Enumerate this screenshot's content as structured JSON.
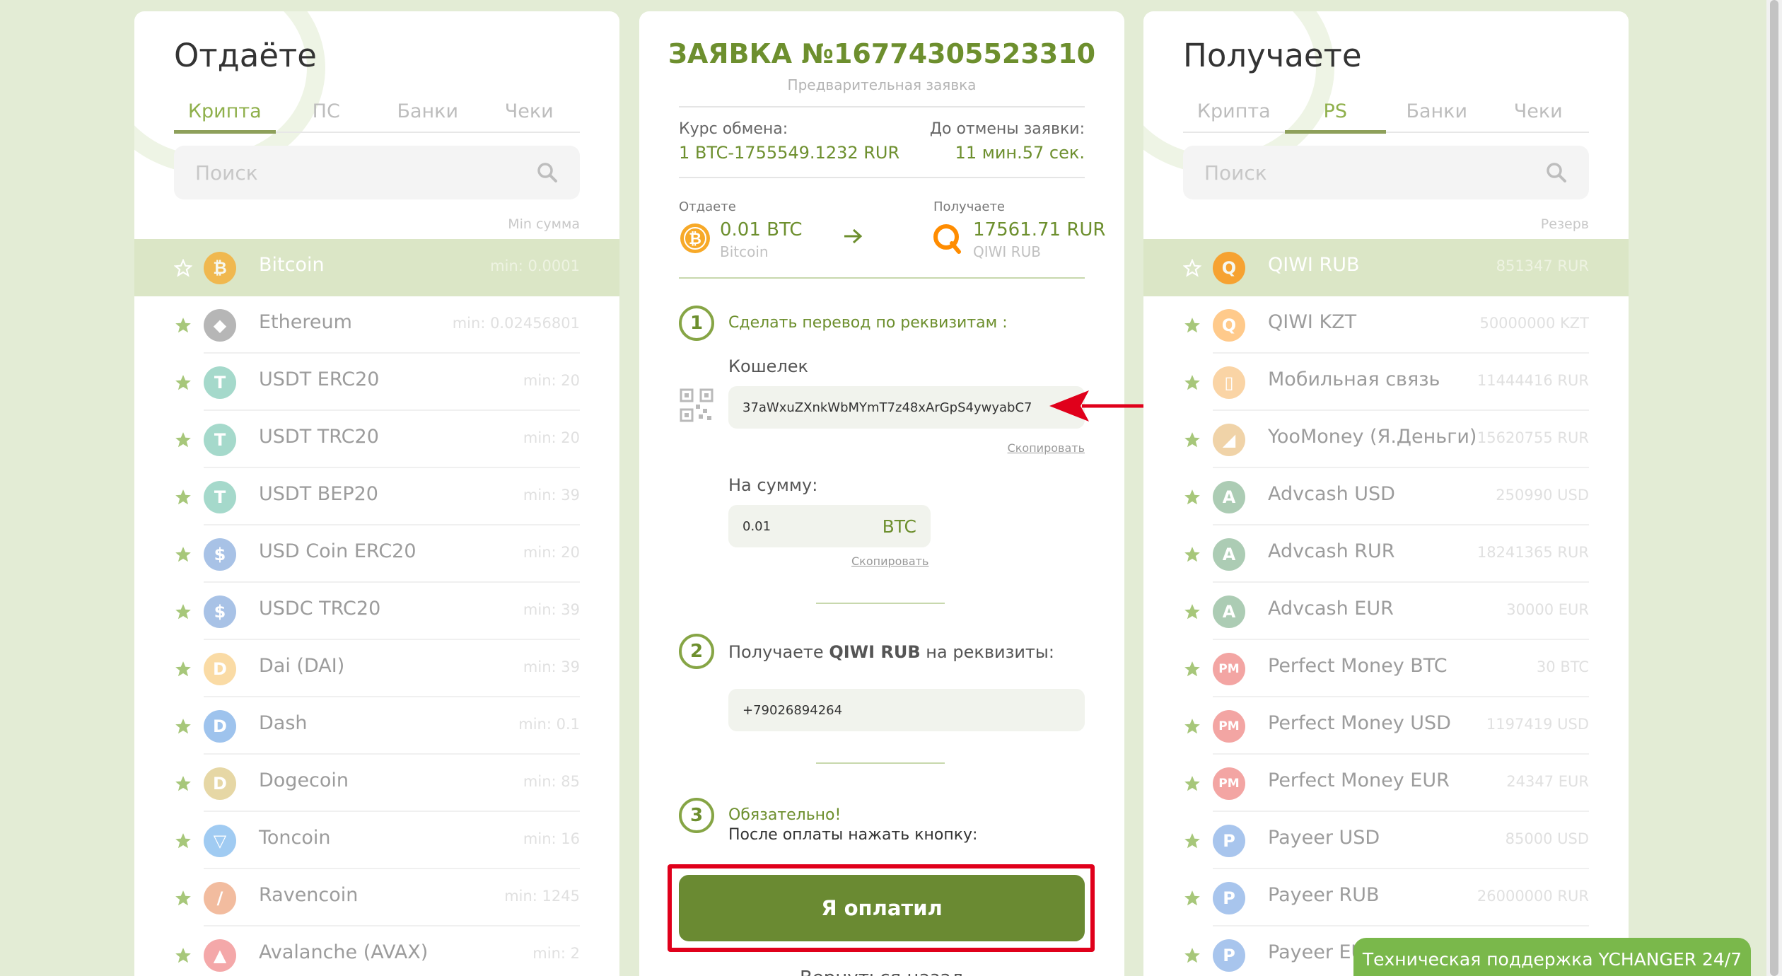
{
  "left_panel": {
    "title": "Отдаёте",
    "tabs": [
      "Крипта",
      "ПС",
      "Банки",
      "Чеки"
    ],
    "active_tab": 0,
    "search_placeholder": "Поиск",
    "col_head": "Min сумма",
    "items": [
      {
        "name": "Bitcoin",
        "amount": "min: 0.0001",
        "icon": "bitcoin-icon",
        "color": "#f7a928",
        "glyph": "₿",
        "active": true
      },
      {
        "name": "Ethereum",
        "amount": "min: 0.02456801",
        "icon": "ethereum-icon",
        "color": "#5e5e5e",
        "glyph": "◆"
      },
      {
        "name": "USDT ERC20",
        "amount": "min: 20",
        "icon": "tether-icon",
        "color": "#3aac8e",
        "glyph": "T"
      },
      {
        "name": "USDT TRC20",
        "amount": "min: 20",
        "icon": "tether-icon",
        "color": "#3aac8e",
        "glyph": "T"
      },
      {
        "name": "USDT BEP20",
        "amount": "min: 39",
        "icon": "tether-icon",
        "color": "#3aac8e",
        "glyph": "T"
      },
      {
        "name": "USD Coin ERC20",
        "amount": "min: 20",
        "icon": "usdc-icon",
        "color": "#3f79c9",
        "glyph": "$"
      },
      {
        "name": "USDC TRC20",
        "amount": "min: 39",
        "icon": "usdc-icon",
        "color": "#3f79c9",
        "glyph": "$"
      },
      {
        "name": "Dai (DAI)",
        "amount": "min: 39",
        "icon": "dai-icon",
        "color": "#f4b13a",
        "glyph": "D"
      },
      {
        "name": "Dash",
        "amount": "min: 0.1",
        "icon": "dash-icon",
        "color": "#2a7bd8",
        "glyph": "D"
      },
      {
        "name": "Dogecoin",
        "amount": "min: 85",
        "icon": "dogecoin-icon",
        "color": "#c8a83a",
        "glyph": "D"
      },
      {
        "name": "Toncoin",
        "amount": "min: 16",
        "icon": "toncoin-icon",
        "color": "#2f8de4",
        "glyph": "▽"
      },
      {
        "name": "Ravencoin",
        "amount": "min: 1245",
        "icon": "ravencoin-icon",
        "color": "#e46c2c",
        "glyph": "/"
      },
      {
        "name": "Avalanche (AVAX)",
        "amount": "min: 2",
        "icon": "avalanche-icon",
        "color": "#e84142",
        "glyph": "▲"
      }
    ]
  },
  "right_panel": {
    "title": "Получаете",
    "tabs": [
      "Крипта",
      "PS",
      "Банки",
      "Чеки"
    ],
    "active_tab": 1,
    "search_placeholder": "Поиск",
    "col_head": "Резерв",
    "items": [
      {
        "name": "QIWI RUB",
        "amount": "851347 RUR",
        "icon": "qiwi-icon",
        "color": "#ff8c00",
        "glyph": "Q",
        "active": true
      },
      {
        "name": "QIWI KZT",
        "amount": "50000000 KZT",
        "icon": "qiwi-icon",
        "color": "#ff8c00",
        "glyph": "Q"
      },
      {
        "name": "Мобильная связь",
        "amount": "11444416 RUR",
        "icon": "mobile-icon",
        "color": "#f5a23a",
        "glyph": "▯"
      },
      {
        "name": "YooMoney (Я.Деньги)",
        "amount": "15620755 RUR",
        "icon": "yoomoney-icon",
        "color": "#e0a040",
        "glyph": "◢"
      },
      {
        "name": "Advcash USD",
        "amount": "250990 USD",
        "icon": "advcash-icon",
        "color": "#4a8f5a",
        "glyph": "A"
      },
      {
        "name": "Advcash RUR",
        "amount": "18241365 RUR",
        "icon": "advcash-icon",
        "color": "#4a8f5a",
        "glyph": "A"
      },
      {
        "name": "Advcash EUR",
        "amount": "30000 EUR",
        "icon": "advcash-icon",
        "color": "#4a8f5a",
        "glyph": "A"
      },
      {
        "name": "Perfect Money BTC",
        "amount": "30 BTC",
        "icon": "perfect-money-icon",
        "color": "#e53935",
        "glyph": "PM"
      },
      {
        "name": "Perfect Money USD",
        "amount": "1197419 USD",
        "icon": "perfect-money-icon",
        "color": "#e53935",
        "glyph": "PM"
      },
      {
        "name": "Perfect Money EUR",
        "amount": "24347 EUR",
        "icon": "perfect-money-icon",
        "color": "#e53935",
        "glyph": "PM"
      },
      {
        "name": "Payeer USD",
        "amount": "85000 USD",
        "icon": "payeer-icon",
        "color": "#3f7fd8",
        "glyph": "P"
      },
      {
        "name": "Payeer RUB",
        "amount": "26000000 RUR",
        "icon": "payeer-icon",
        "color": "#3f7fd8",
        "glyph": "P"
      },
      {
        "name": "Payeer EUR",
        "amount": "",
        "icon": "payeer-icon",
        "color": "#3f7fd8",
        "glyph": "P"
      }
    ]
  },
  "order": {
    "title": "ЗАЯВКА №16774305523310",
    "subtitle": "Предварительная заявка",
    "rate_label": "Курс обмена:",
    "rate_value": "1 BTC-1755549.1232 RUR",
    "cancel_label": "До отмены заявки:",
    "cancel_value": "11 мин.57 сек.",
    "give_label": "Отдаете",
    "give_amount": "0.01 BTC",
    "give_currency": "Bitcoin",
    "get_label": "Получаете",
    "get_amount": "17561.71 RUR",
    "get_currency": "QIWI RUB",
    "step1_num": "1",
    "step1_text": "Сделать перевод по реквизитам :",
    "wallet_label": "Кошелек",
    "wallet_value": "37aWxuZXnkWbMYmT7z48xArGpS4ywyabC7",
    "copy_label": "Скопировать",
    "sum_label": "На сумму:",
    "sum_value": "0.01",
    "sum_currency": "BTC",
    "step2_num": "2",
    "step2_prefix": "Получаете ",
    "step2_bold": "QIWI RUB",
    "step2_suffix": " на реквизиты:",
    "phone_value": "+79026894264",
    "step3_num": "3",
    "step3_line1": "Обязательно!",
    "step3_line2": "После оплаты нажать кнопку:",
    "pay_button": "Я оплатил",
    "back_link": "Вернуться назад"
  },
  "support": {
    "label": "Техническая поддержка YCHANGER 24/7"
  },
  "colors": {
    "accent": "#6a8a32",
    "highlight": "#e0001b",
    "background": "#e3ecd5"
  }
}
